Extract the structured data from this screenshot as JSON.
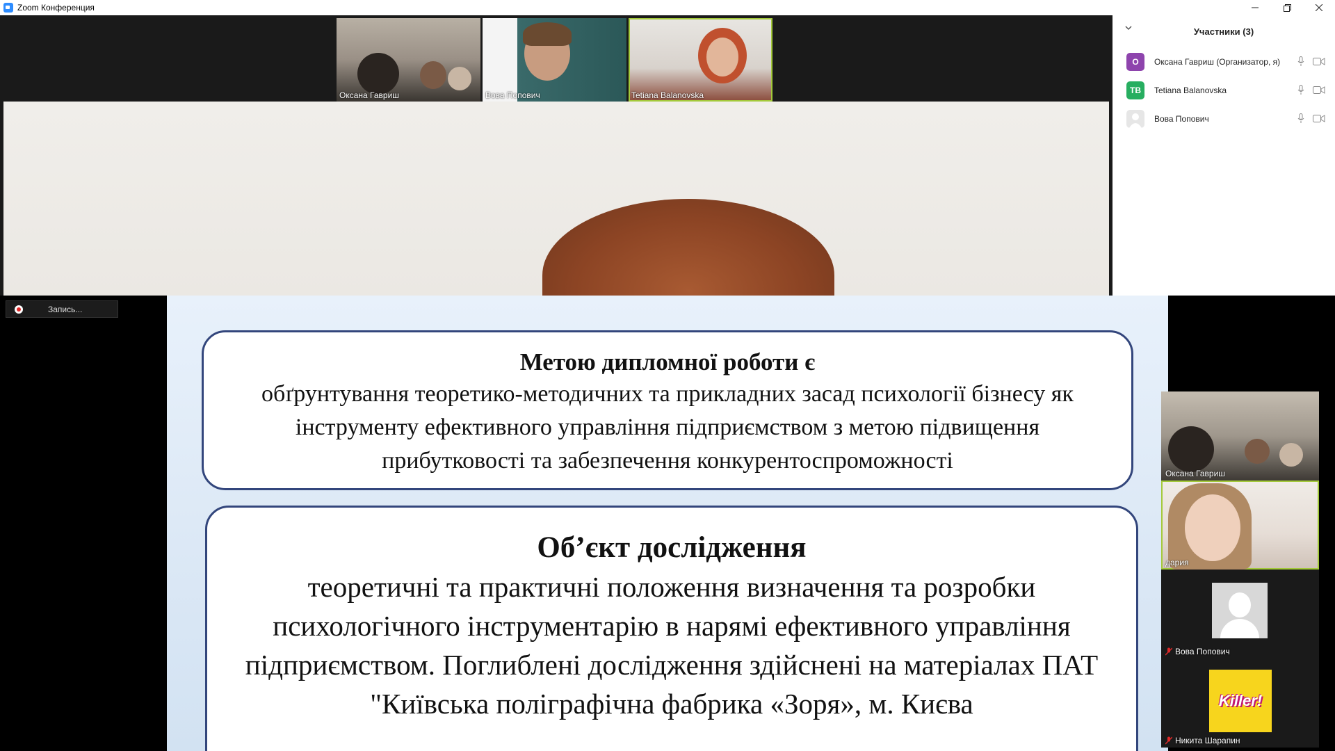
{
  "window": {
    "title": "Zoom Конференция"
  },
  "top_thumbnails": [
    {
      "name": "Оксана Гавриш"
    },
    {
      "name": "Вова Попович"
    },
    {
      "name": "Tetiana Balanovska"
    }
  ],
  "participants_panel": {
    "title": "Участники (3)",
    "items": [
      {
        "initials": "О",
        "name": "Оксана Гавриш (Организатор, я)",
        "color": "#8e44ad"
      },
      {
        "initials": "ТВ",
        "name": "Tetiana Balanovska",
        "color": "#27ae60"
      },
      {
        "initials": "",
        "name": "Вова Попович",
        "color": "#e6e6e6"
      }
    ]
  },
  "recording": {
    "label": "Запись..."
  },
  "slide": {
    "box1": {
      "heading": "Метою дипломної роботи є",
      "body": "обґрунтування теоретико-методичних та прикладних засад психології бізнесу як інструменту ефективного управління підприємством з метою підвищення прибутковості та забезпечення конкурентоспроможності"
    },
    "box2": {
      "heading": "Об’єкт дослідження",
      "body": "теоретичні та практичні положення визначення та розробки психологічного інструментарію в нарямі ефективного управління підприємством. Поглиблені дослідження здійснені на матеріалах ПАТ \"Київська поліграфічна фабрика «Зоря», м. Києва"
    }
  },
  "side_thumbnails": [
    {
      "name": "Оксана Гавриш",
      "muted": false
    },
    {
      "name": "дария",
      "muted": false
    },
    {
      "name": "Вова Попович",
      "muted": true
    },
    {
      "name": "Никита Шарапин",
      "muted": true,
      "sticker": "Killer!"
    }
  ],
  "colors": {
    "active_speaker": "#a3c93a",
    "slide_border": "#33467c",
    "zoom_blue": "#2D8CFF"
  }
}
